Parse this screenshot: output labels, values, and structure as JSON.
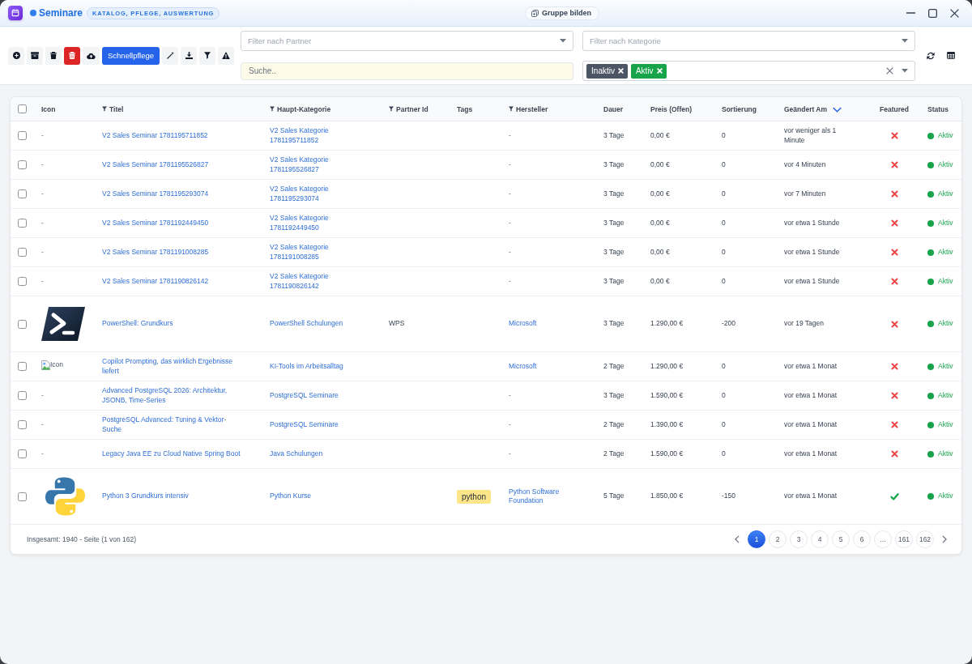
{
  "window": {
    "title": "Seminare",
    "subtitle": "KATALOG, PFLEGE, AUSWERTUNG",
    "group_button": "Gruppe bilden"
  },
  "toolbar": {
    "buttons": [
      {
        "kind": "icon"
      },
      {
        "kind": "icon"
      },
      {
        "kind": "icon"
      },
      {
        "kind": "icon"
      },
      {
        "kind": "icon"
      },
      {
        "kind": "text",
        "label": "Schnellpflege"
      },
      {
        "kind": "icon"
      },
      {
        "kind": "icon"
      },
      {
        "kind": "icon"
      },
      {
        "kind": "icon"
      }
    ]
  },
  "filters": {
    "partner": {
      "placeholder": "Filter nach Partner"
    },
    "category": {
      "placeholder": "Filter nach Kategorie"
    },
    "search": {
      "placeholder": "Suche.."
    },
    "status": {
      "tags": [
        {
          "label": "Inaktiv",
          "color": "#4b5563"
        },
        {
          "label": "Aktiv",
          "color": "#16a34a"
        }
      ]
    }
  },
  "table": {
    "select_all": {
      "checked": false
    },
    "columns": [
      {
        "label": "Icon",
        "filter": false,
        "sorted": false
      },
      {
        "label": "Titel",
        "filter": true,
        "sorted": false
      },
      {
        "label": "Haupt-Kategorie",
        "filter": true,
        "sorted": false
      },
      {
        "label": "Partner Id",
        "filter": true,
        "sorted": false
      },
      {
        "label": "Tags",
        "filter": false,
        "sorted": false
      },
      {
        "label": "Hersteller",
        "filter": true,
        "sorted": false
      },
      {
        "label": "Dauer",
        "filter": false,
        "sorted": false
      },
      {
        "label": "Preis (Offen)",
        "filter": false,
        "sorted": false
      },
      {
        "label": "Sortierung",
        "filter": false,
        "sorted": false
      },
      {
        "label": "Geändert Am",
        "filter": false,
        "sorted": true
      },
      {
        "label": "Featured",
        "filter": false,
        "sorted": false
      },
      {
        "label": "Status",
        "filter": false,
        "sorted": false
      }
    ],
    "rows": [
      {
        "selected": false,
        "icon": {
          "kind": "text",
          "text": "-"
        },
        "title": "V2 Sales Seminar 1781195711852",
        "category": "V2 Sales Kategorie 1781195711852",
        "manufacturer": {
          "text": "-",
          "link": false
        },
        "duration": "3 Tage",
        "price": "0,00 €",
        "sort_order": "0",
        "changed": "vor weniger als 1 Minute",
        "featured": false,
        "status": {
          "label": "Aktiv",
          "active": true
        }
      },
      {
        "selected": false,
        "icon": {
          "kind": "text",
          "text": "-"
        },
        "title": "V2 Sales Seminar 1781195526827",
        "category": "V2 Sales Kategorie 1781195526827",
        "manufacturer": {
          "text": "-",
          "link": false
        },
        "duration": "3 Tage",
        "price": "0,00 €",
        "sort_order": "0",
        "changed": "vor 4 Minuten",
        "featured": false,
        "status": {
          "label": "Aktiv",
          "active": true
        }
      },
      {
        "selected": false,
        "icon": {
          "kind": "text",
          "text": "-"
        },
        "title": "V2 Sales Seminar 1781195293074",
        "category": "V2 Sales Kategorie 1781195293074",
        "manufacturer": {
          "text": "-",
          "link": false
        },
        "duration": "3 Tage",
        "price": "0,00 €",
        "sort_order": "0",
        "changed": "vor 7 Minuten",
        "featured": false,
        "status": {
          "label": "Aktiv",
          "active": true
        }
      },
      {
        "selected": false,
        "icon": {
          "kind": "text",
          "text": "-"
        },
        "title": "V2 Sales Seminar 1781192449450",
        "category": "V2 Sales Kategorie 1781192449450",
        "manufacturer": {
          "text": "-",
          "link": false
        },
        "duration": "3 Tage",
        "price": "0,00 €",
        "sort_order": "0",
        "changed": "vor etwa 1 Stunde",
        "featured": false,
        "status": {
          "label": "Aktiv",
          "active": true
        }
      },
      {
        "selected": false,
        "icon": {
          "kind": "text",
          "text": "-"
        },
        "title": "V2 Sales Seminar 1781191008285",
        "category": "V2 Sales Kategorie 1781191008285",
        "manufacturer": {
          "text": "-",
          "link": false
        },
        "duration": "3 Tage",
        "price": "0,00 €",
        "sort_order": "0",
        "changed": "vor etwa 1 Stunde",
        "featured": false,
        "status": {
          "label": "Aktiv",
          "active": true
        }
      },
      {
        "selected": false,
        "icon": {
          "kind": "text",
          "text": "-"
        },
        "title": "V2 Sales Seminar 1781190826142",
        "category": "V2 Sales Kategorie 1781190826142",
        "manufacturer": {
          "text": "-",
          "link": false
        },
        "duration": "3 Tage",
        "price": "0,00 €",
        "sort_order": "0",
        "changed": "vor etwa 1 Stunde",
        "featured": false,
        "status": {
          "label": "Aktiv",
          "active": true
        }
      },
      {
        "selected": false,
        "icon": {
          "kind": "terminal-logo"
        },
        "title": "PowerShell: Grundkurs",
        "category": "PowerShell Schulungen",
        "partner_id": "WPS",
        "manufacturer": {
          "text": "Microsoft",
          "link": true
        },
        "duration": "3 Tage",
        "price": "1.290,00 €",
        "sort_order": "-200",
        "changed": "vor 19 Tagen",
        "featured": false,
        "status": {
          "label": "Aktiv",
          "active": true
        }
      },
      {
        "selected": false,
        "icon": {
          "kind": "broken-image",
          "alt": "Icon"
        },
        "title": "Copilot Prompting, das wirklich Ergebnisse liefert",
        "category": "KI-Tools im Arbeitsalltag",
        "manufacturer": {
          "text": "Microsoft",
          "link": true
        },
        "duration": "2 Tage",
        "price": "1.290,00 €",
        "sort_order": "0",
        "changed": "vor etwa 1 Monat",
        "featured": false,
        "status": {
          "label": "Aktiv",
          "active": true
        }
      },
      {
        "selected": false,
        "icon": {
          "kind": "text",
          "text": "-"
        },
        "title": "Advanced PostgreSQL 2026: Architektur, JSONB, Time-Series",
        "category": "PostgreSQL Seminare",
        "manufacturer": {
          "text": "-",
          "link": false
        },
        "duration": "3 Tage",
        "price": "1.590,00 €",
        "sort_order": "0",
        "changed": "vor etwa 1 Monat",
        "featured": false,
        "status": {
          "label": "Aktiv",
          "active": true
        }
      },
      {
        "selected": false,
        "icon": {
          "kind": "text",
          "text": "-"
        },
        "title": "PostgreSQL Advanced: Tuning & Vektor-Suche",
        "category": "PostgreSQL Seminare",
        "manufacturer": {
          "text": "-",
          "link": false
        },
        "duration": "2 Tage",
        "price": "1.390,00 €",
        "sort_order": "0",
        "changed": "vor etwa 1 Monat",
        "featured": false,
        "status": {
          "label": "Aktiv",
          "active": true
        }
      },
      {
        "selected": false,
        "icon": {
          "kind": "text",
          "text": "-"
        },
        "title": "Legacy Java EE zu Cloud Native Spring Boot",
        "category": "Java Schulungen",
        "manufacturer": {
          "text": "-",
          "link": false
        },
        "duration": "2 Tage",
        "price": "1.590,00 €",
        "sort_order": "0",
        "changed": "vor etwa 1 Monat",
        "featured": false,
        "status": {
          "label": "Aktiv",
          "active": true
        }
      },
      {
        "selected": false,
        "icon": {
          "kind": "snake-logo"
        },
        "title": "Python 3 Grundkurs intensiv",
        "category": "Python Kurse",
        "tags": [
          "python"
        ],
        "manufacturer": {
          "text": "Python Software Foundation",
          "link": true
        },
        "duration": "5 Tage",
        "price": "1.850,00 €",
        "sort_order": "-150",
        "changed": "vor etwa 1 Monat",
        "featured": true,
        "status": {
          "label": "Aktiv",
          "active": true
        }
      }
    ],
    "footer": {
      "summary": "Insgesamt: 1940 - Seite (1 von 162)",
      "pages": [
        {
          "label": "1",
          "selected": true
        },
        {
          "label": "2",
          "selected": false
        },
        {
          "label": "3",
          "selected": false
        },
        {
          "label": "4",
          "selected": false
        },
        {
          "label": "5",
          "selected": false
        },
        {
          "label": "6",
          "selected": false
        },
        {
          "label": "...",
          "selected": false
        },
        {
          "label": "161",
          "selected": false
        },
        {
          "label": "162",
          "selected": false
        }
      ]
    }
  }
}
